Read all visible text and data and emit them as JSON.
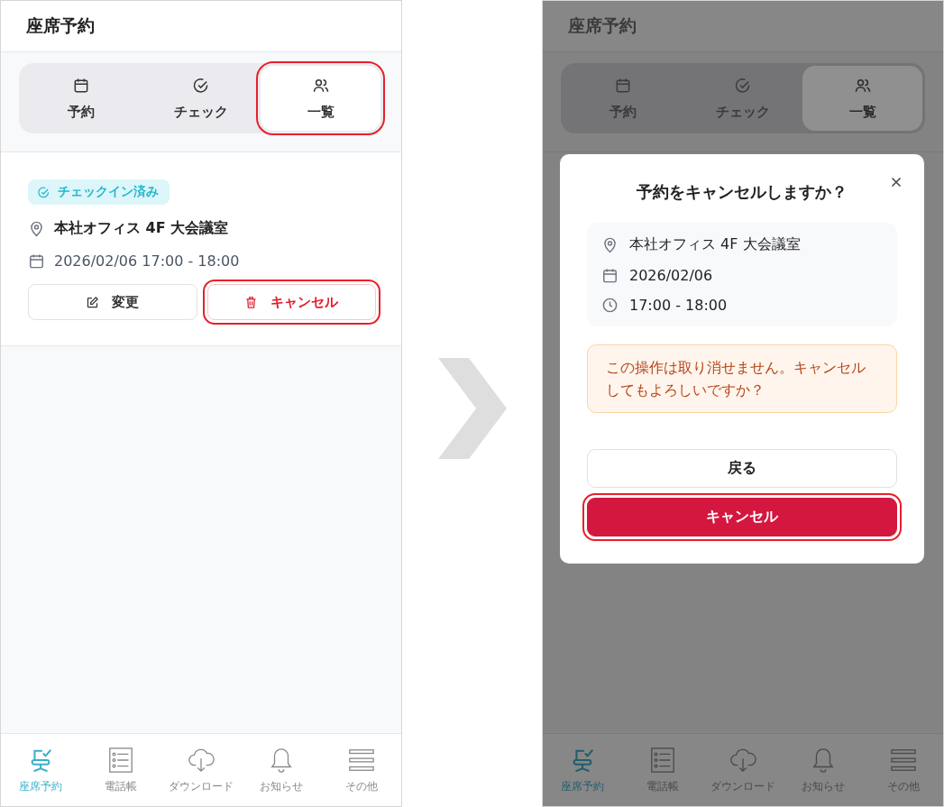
{
  "screens": [
    {
      "header_title": "座席予約",
      "dimmed": false,
      "tabs": [
        {
          "label": "予約",
          "selected": false,
          "highlighted": false
        },
        {
          "label": "チェック",
          "selected": false,
          "highlighted": false
        },
        {
          "label": "一覧",
          "selected": true,
          "highlighted": true
        }
      ],
      "card": {
        "status_badge": "チェックイン済み",
        "location": "本社オフィス 4F 大会議室",
        "datetime": "2026/02/06 17:00 - 18:00",
        "buttons": [
          {
            "label": "変更",
            "kind": "edit",
            "highlighted": false
          },
          {
            "label": "キャンセル",
            "kind": "cancel",
            "highlighted": true
          }
        ]
      },
      "bottom_nav": [
        {
          "label": "座席予約",
          "selected": true
        },
        {
          "label": "電話帳",
          "selected": false
        },
        {
          "label": "ダウンロード",
          "selected": false
        },
        {
          "label": "お知らせ",
          "selected": false
        },
        {
          "label": "その他",
          "selected": false
        }
      ]
    },
    {
      "header_title": "座席予約",
      "dimmed": true,
      "tabs": [
        {
          "label": "予約",
          "selected": false,
          "highlighted": false
        },
        {
          "label": "チェック",
          "selected": false,
          "highlighted": false
        },
        {
          "label": "一覧",
          "selected": true,
          "highlighted": false
        }
      ],
      "dialog": {
        "title": "予約をキャンセルしますか？",
        "location": "本社オフィス 4F 大会議室",
        "date": "2026/02/06",
        "time": "17:00 - 18:00",
        "warning": "この操作は取り消せません。キャンセルしてもよろしいですか？",
        "buttons": [
          {
            "label": "戻る",
            "kind": "back",
            "highlighted": false
          },
          {
            "label": "キャンセル",
            "kind": "confirm",
            "highlighted": true
          }
        ]
      },
      "bottom_nav": [
        {
          "label": "座席予約",
          "selected": true
        },
        {
          "label": "電話帳",
          "selected": false
        },
        {
          "label": "ダウンロード",
          "selected": false
        },
        {
          "label": "お知らせ",
          "selected": false
        },
        {
          "label": "その他",
          "selected": false
        }
      ]
    }
  ]
}
